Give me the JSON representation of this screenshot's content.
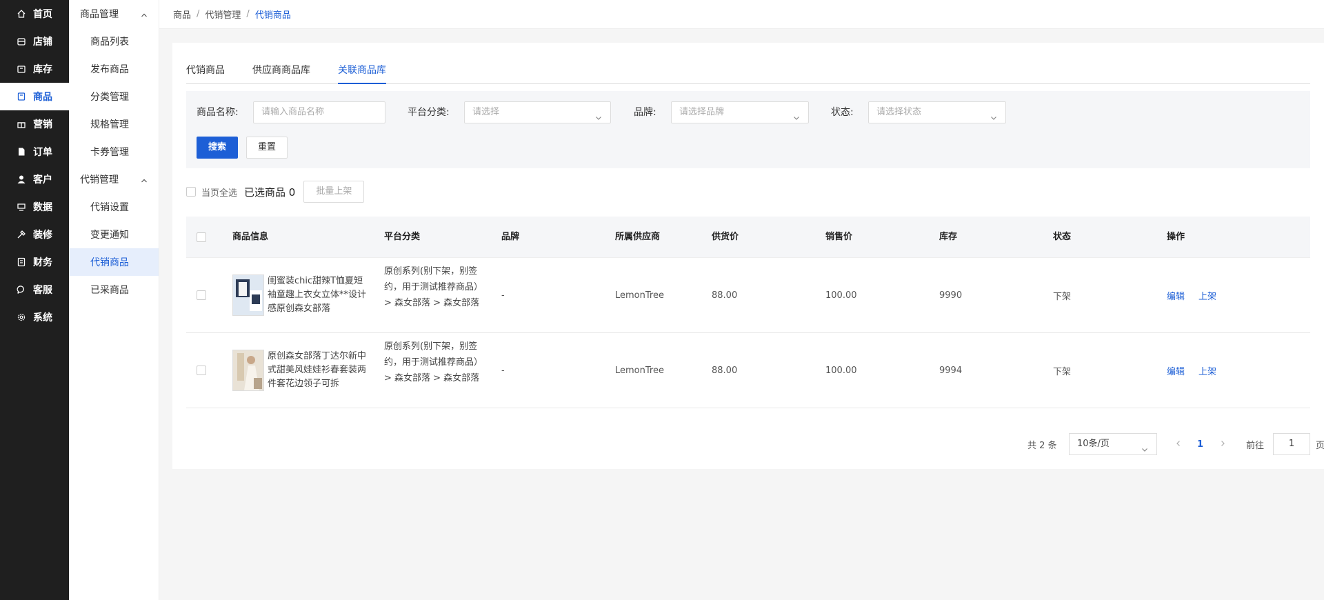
{
  "nav": {
    "items": [
      {
        "label": "首页",
        "icon": "home-icon"
      },
      {
        "label": "店铺",
        "icon": "shop-icon"
      },
      {
        "label": "库存",
        "icon": "inventory-icon"
      },
      {
        "label": "商品",
        "icon": "goods-icon",
        "active": true
      },
      {
        "label": "营销",
        "icon": "gift-icon"
      },
      {
        "label": "订单",
        "icon": "order-icon"
      },
      {
        "label": "客户",
        "icon": "user-icon"
      },
      {
        "label": "数据",
        "icon": "data-icon"
      },
      {
        "label": "装修",
        "icon": "decorate-icon"
      },
      {
        "label": "财务",
        "icon": "finance-icon"
      },
      {
        "label": "客服",
        "icon": "chat-icon"
      },
      {
        "label": "系统",
        "icon": "gear-icon"
      }
    ]
  },
  "subnav": {
    "group1": "商品管理",
    "group1_items": [
      "商品列表",
      "发布商品",
      "分类管理",
      "规格管理",
      "卡券管理"
    ],
    "group2": "代销管理",
    "group2_items": [
      "代销设置",
      "变更通知",
      "代销商品",
      "已采商品"
    ]
  },
  "breadcrumb": {
    "a": "商品",
    "b": "代销管理",
    "c": "代销商品",
    "sep": "/"
  },
  "tabs": [
    "代销商品",
    "供应商商品库",
    "关联商品库"
  ],
  "filter": {
    "name_label": "商品名称:",
    "name_placeholder": "请输入商品名称",
    "cat_label": "平台分类:",
    "cat_placeholder": "请选择",
    "brand_label": "品牌:",
    "brand_placeholder": "请选择品牌",
    "status_label": "状态:",
    "status_placeholder": "请选择状态",
    "search": "搜索",
    "reset": "重置"
  },
  "bulk": {
    "select_all": "当页全选",
    "selected": "已选商品 0",
    "batch_on": "批量上架"
  },
  "table": {
    "headers": {
      "info": "商品信息",
      "cat": "平台分类",
      "brand": "品牌",
      "supplier": "所属供应商",
      "supply_price": "供货价",
      "sale_price": "销售价",
      "stock": "库存",
      "status": "状态",
      "op": "操作"
    },
    "rows": [
      {
        "name": "闺蜜装chic甜辣T恤夏短袖童趣上衣女立体**设计感原创森女部落",
        "cat": "原创系列(别下架，别签约，用于测试推荐商品） > 森女部落 > 森女部落",
        "brand": "-",
        "supplier": "LemonTree",
        "supply_price": "88.00",
        "sale_price": "100.00",
        "stock": "9990",
        "status": "下架",
        "edit": "编辑",
        "on": "上架"
      },
      {
        "name": "原创森女部落丁达尔新中式甜美风娃娃衫春套装两件套花边领子可拆",
        "cat": "原创系列(别下架，别签约，用于测试推荐商品） > 森女部落 > 森女部落",
        "brand": "-",
        "supplier": "LemonTree",
        "supply_price": "88.00",
        "sale_price": "100.00",
        "stock": "9994",
        "status": "下架",
        "edit": "编辑",
        "on": "上架"
      }
    ]
  },
  "pager": {
    "total": "共 2 条",
    "size": "10条/页",
    "current": "1",
    "goto": "前往",
    "input": "1",
    "unit": "页"
  },
  "colors": {
    "accent": "#1d5fd6",
    "nav_bg": "#1f1f1f"
  }
}
